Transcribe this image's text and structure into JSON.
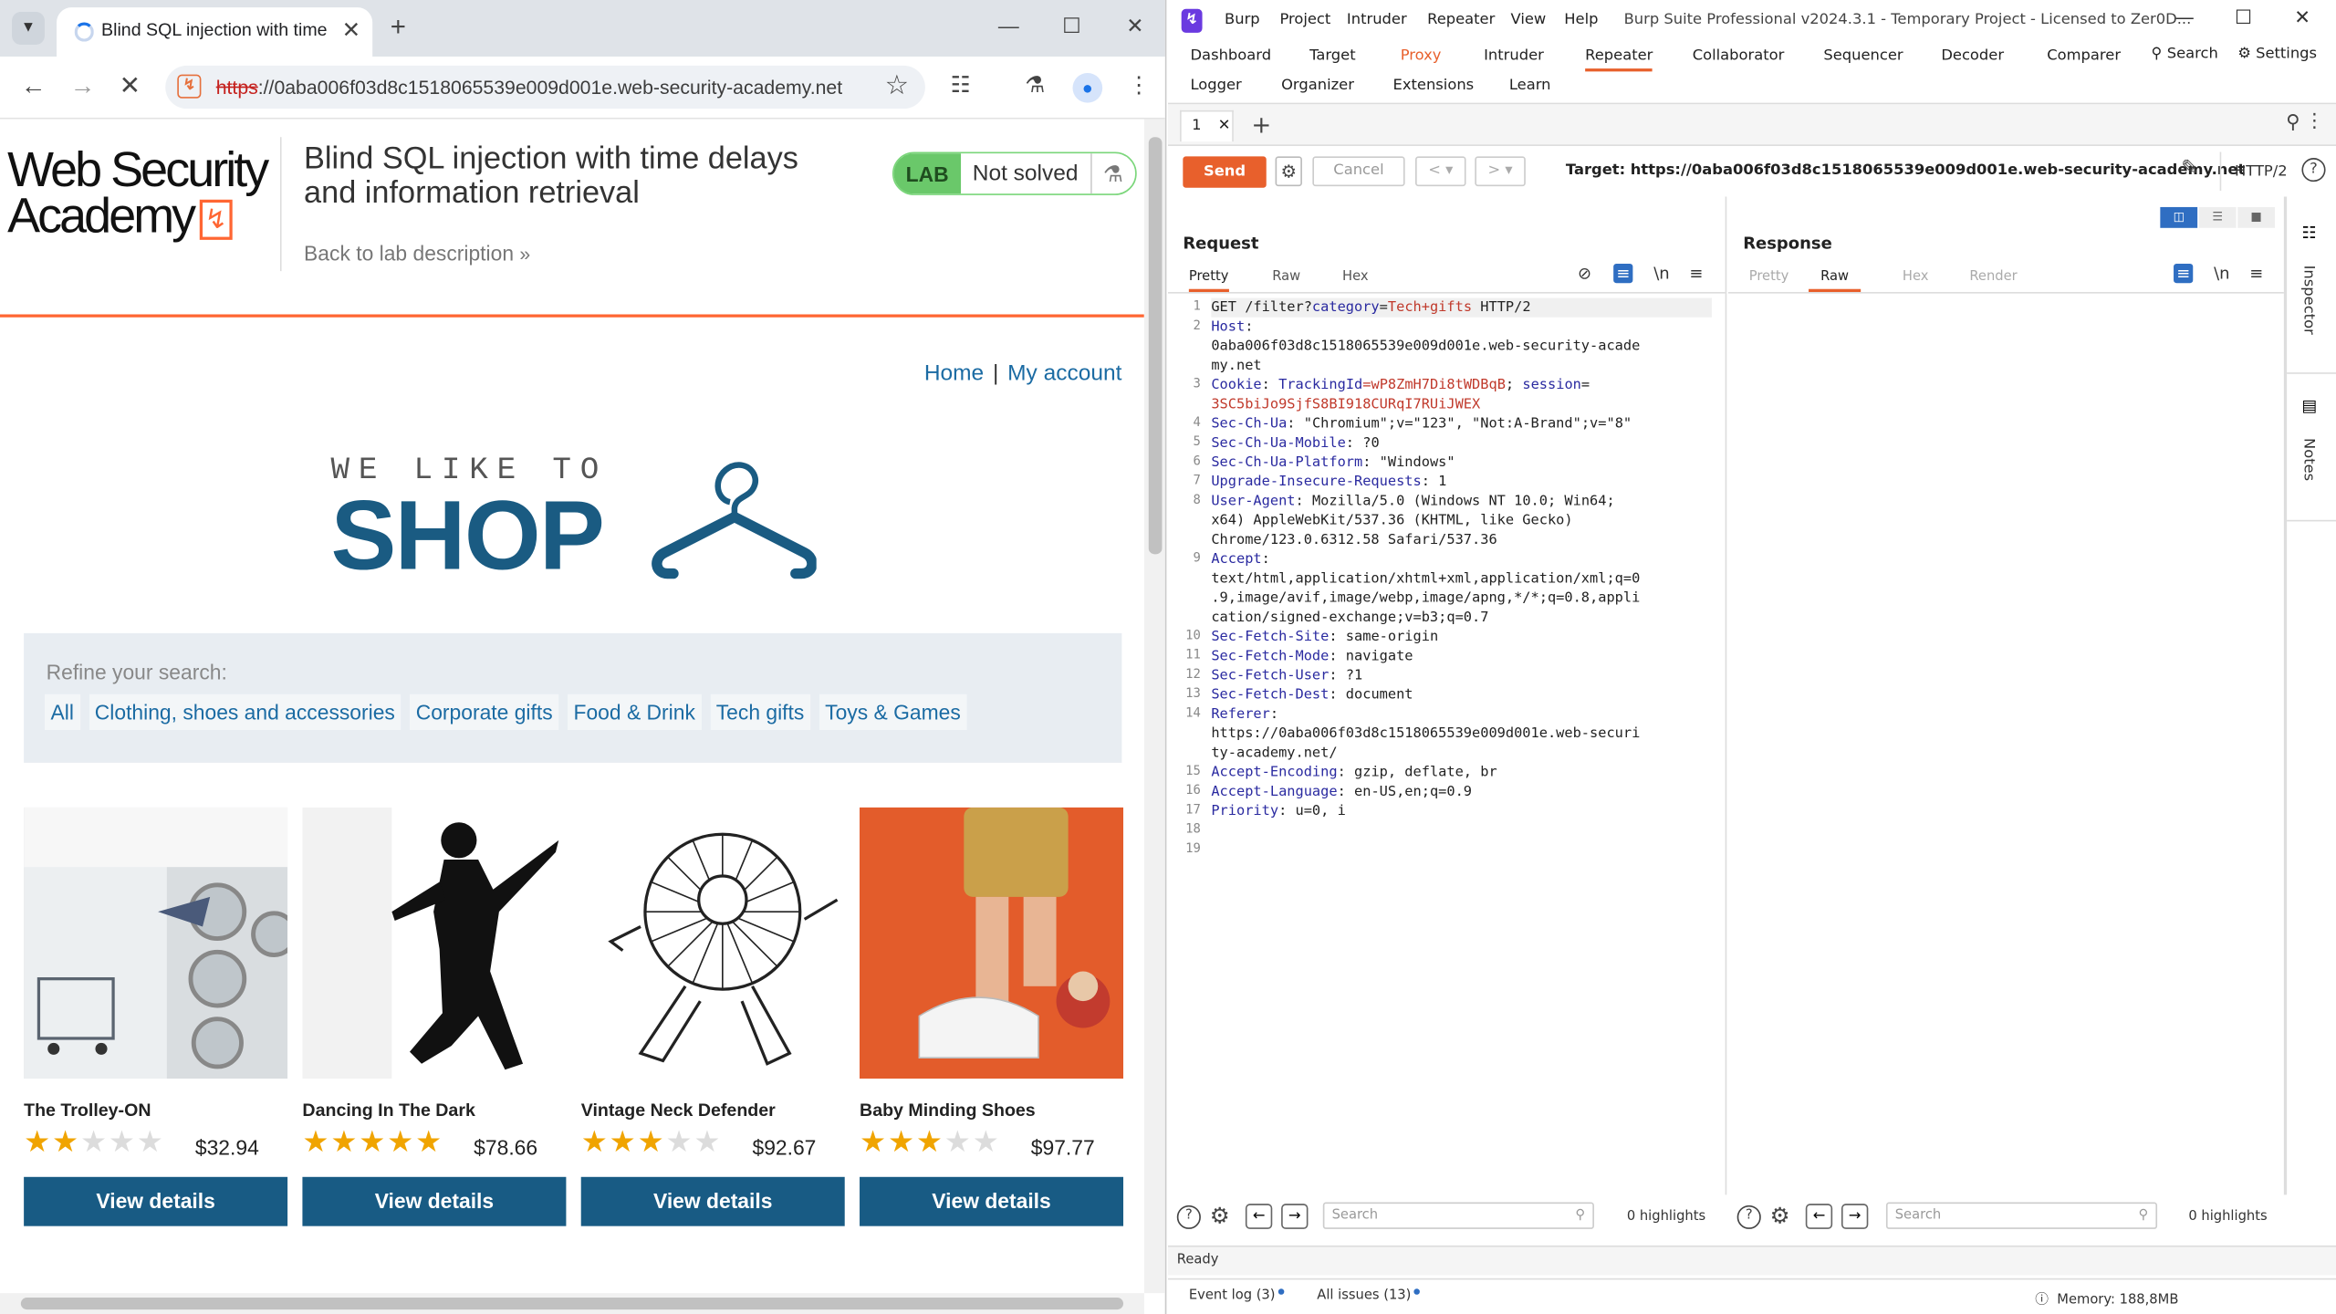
{
  "browser": {
    "tab_title": "Blind SQL injection with time d",
    "url_scheme": "https",
    "url_rest": "://0aba006f03d8c1518065539e009d001e.web-security-academy.net"
  },
  "lab": {
    "logo_line1": "Web Security",
    "logo_line2": "Academy",
    "title_line1": "Blind SQL injection with time delays",
    "title_line2": "and information retrieval",
    "back_link": "Back to lab description",
    "badge_lab": "LAB",
    "badge_status": "Not solved"
  },
  "shop": {
    "nav_home": "Home",
    "nav_sep": "|",
    "nav_account": "My account",
    "tagline": "WE LIKE TO",
    "banner": "SHOP",
    "refine_label": "Refine your search:",
    "categories": [
      "All",
      "Clothing, shoes and accessories",
      "Corporate gifts",
      "Food & Drink",
      "Tech gifts",
      "Toys & Games"
    ],
    "products": [
      {
        "name": "The Trolley-ON",
        "rating": 2,
        "price": "$32.94",
        "button": "View details"
      },
      {
        "name": "Dancing In The Dark",
        "rating": 5,
        "price": "$78.66",
        "button": "View details"
      },
      {
        "name": "Vintage Neck Defender",
        "rating": 3,
        "price": "$92.67",
        "button": "View details"
      },
      {
        "name": "Baby Minding Shoes",
        "rating": 3,
        "price": "$97.77",
        "button": "View details"
      }
    ]
  },
  "burp": {
    "menu": [
      "Burp",
      "Project",
      "Intruder",
      "Repeater",
      "View",
      "Help"
    ],
    "window_title": "Burp Suite Professional v2024.3.1 - Temporary Project - Licensed to Zer0D...",
    "tabs_row1": [
      "Dashboard",
      "Target",
      "Proxy",
      "Intruder",
      "Repeater",
      "Collaborator",
      "Sequencer",
      "Decoder",
      "Comparer"
    ],
    "tabs_row2": [
      "Logger",
      "Organizer",
      "Extensions",
      "Learn"
    ],
    "search_label": "Search",
    "settings_label": "Settings",
    "repeater_tab": "1",
    "send": "Send",
    "cancel": "Cancel",
    "target": "Target: https://0aba006f03d8c1518065539e009d001e.web-security-academy.net",
    "http_version": "HTTP/2",
    "request_title": "Request",
    "response_title": "Response",
    "request_tabs": [
      "Pretty",
      "Raw",
      "Hex"
    ],
    "response_tabs": [
      "Pretty",
      "Raw",
      "Hex",
      "Render"
    ],
    "search_placeholder": "Search",
    "highlights": "0 highlights",
    "inspector": "Inspector",
    "notes": "Notes",
    "status": "Ready",
    "event_log": "Event log (3)",
    "all_issues": "All issues (13)",
    "memory": "Memory: 188,8MB",
    "request_lines": [
      "GET /filter?category=Tech+gifts HTTP/2",
      "Host:",
      "0aba006f03d8c1518065539e009d001e.web-security-acade",
      "my.net",
      "Cookie: TrackingId=wP8ZmH7Di8tWDBqB; session=",
      "3SC5biJo9SjfS8BI918CURqI7RUiJWEX",
      "Sec-Ch-Ua: \"Chromium\";v=\"123\", \"Not:A-Brand\";v=\"8\"",
      "Sec-Ch-Ua-Mobile: ?0",
      "Sec-Ch-Ua-Platform: \"Windows\"",
      "Upgrade-Insecure-Requests: 1",
      "User-Agent: Mozilla/5.0 (Windows NT 10.0; Win64;",
      "x64) AppleWebKit/537.36 (KHTML, like Gecko)",
      "Chrome/123.0.6312.58 Safari/537.36",
      "Accept:",
      "text/html,application/xhtml+xml,application/xml;q=0",
      ".9,image/avif,image/webp,image/apng,*/*;q=0.8,appli",
      "cation/signed-exchange;v=b3;q=0.7",
      "Sec-Fetch-Site: same-origin",
      "Sec-Fetch-Mode: navigate",
      "Sec-Fetch-User: ?1",
      "Sec-Fetch-Dest: document",
      "Referer:",
      "https://0aba006f03d8c1518065539e009d001e.web-securi",
      "ty-academy.net/",
      "Accept-Encoding: gzip, deflate, br",
      "Accept-Language: en-US,en;q=0.9",
      "Priority: u=0, i",
      "",
      ""
    ],
    "line_numbers": [
      "1",
      "2",
      "",
      "",
      "3",
      "",
      "4",
      "5",
      "6",
      "7",
      "8",
      "",
      "",
      "9",
      "",
      "",
      "",
      "10",
      "11",
      "12",
      "13",
      "14",
      "",
      "",
      "15",
      "16",
      "17",
      "18",
      "19"
    ]
  }
}
